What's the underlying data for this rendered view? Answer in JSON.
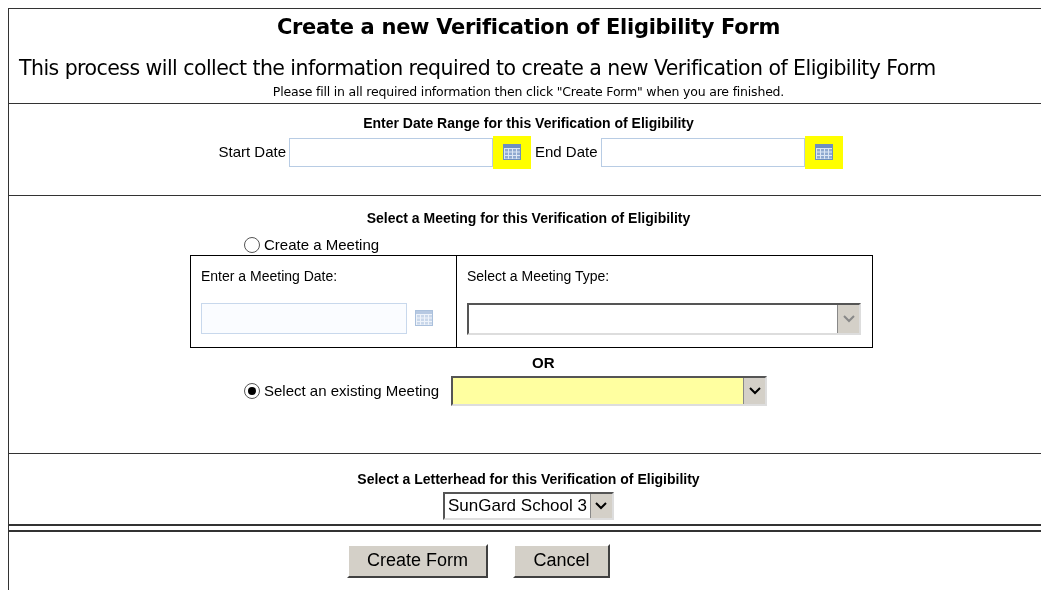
{
  "title": "Create a new Verification of Eligibility Form",
  "intro": "This process will collect the information required to create a new Verification of Eligibility Form",
  "instructions": "Please fill in all required information then click \"Create Form\" when you are finished.",
  "date_range": {
    "heading": "Enter Date Range for this Verification of Eligibility",
    "fields": [
      {
        "label": "Start Date",
        "highlighted": true
      },
      {
        "label": "End Date",
        "highlighted": true
      }
    ]
  },
  "meeting": {
    "heading": "Select a Meeting for this Verification of Eligibility",
    "options": [
      {
        "label": "Create a Meeting",
        "selected": false
      },
      {
        "label": "Select an existing Meeting",
        "selected": true
      }
    ],
    "meeting_date_label": "Enter a Meeting Date:",
    "meeting_date_disabled": true,
    "meeting_type_label": "Select a Meeting Type:",
    "or_label": "OR"
  },
  "letterhead": {
    "heading": "Select a Letterhead for this Verification of Eligibility",
    "value": "SunGard School 3"
  },
  "buttons": [
    "Create Form",
    "Cancel"
  ]
}
